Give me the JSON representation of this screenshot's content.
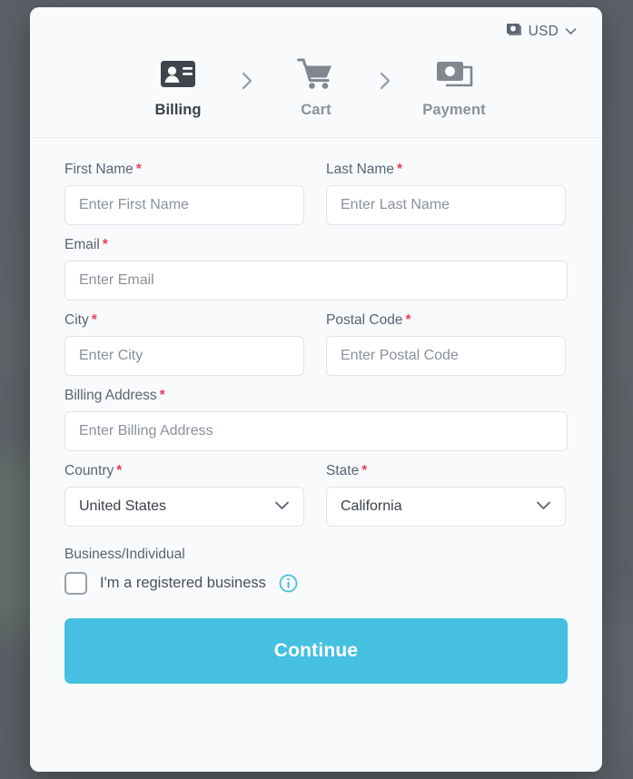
{
  "overlay": {
    "backdrop_color": "#5c6268"
  },
  "modal": {
    "background": "#f9fafc",
    "currency": {
      "icon": "banknotes-icon",
      "label": "USD",
      "chevron": "chevron-down-icon"
    },
    "steps": [
      {
        "id": "billing",
        "label": "Billing",
        "icon": "id-card-icon",
        "state": "active"
      },
      {
        "id": "cart",
        "label": "Cart",
        "icon": "shopping-cart-icon",
        "state": "inactive"
      },
      {
        "id": "payment",
        "label": "Payment",
        "icon": "banknotes-icon",
        "state": "inactive"
      }
    ],
    "step_separator_icon": "chevron-right-icon"
  },
  "form": {
    "first_name": {
      "label": "First Name",
      "required": "*",
      "placeholder": "Enter First Name",
      "value": ""
    },
    "last_name": {
      "label": "Last Name",
      "required": "*",
      "placeholder": "Enter Last Name",
      "value": ""
    },
    "email": {
      "label": "Email",
      "required": "*",
      "placeholder": "Enter Email",
      "value": ""
    },
    "city": {
      "label": "City",
      "required": "*",
      "placeholder": "Enter City",
      "value": ""
    },
    "postal_code": {
      "label": "Postal Code",
      "required": "*",
      "placeholder": "Enter Postal Code",
      "value": ""
    },
    "billing_address": {
      "label": "Billing Address",
      "required": "*",
      "placeholder": "Enter Billing Address",
      "value": ""
    },
    "country": {
      "label": "Country",
      "required": "*",
      "value": "United States",
      "chevron": "chevron-down-icon"
    },
    "state": {
      "label": "State",
      "required": "*",
      "value": "California",
      "chevron": "chevron-down-icon"
    },
    "business": {
      "section_label": "Business/Individual",
      "checkbox_label": "I'm a registered business",
      "checked": false,
      "info_icon": "info-circle-icon",
      "info_icon_color": "#45c0e0"
    }
  },
  "actions": {
    "continue_label": "Continue",
    "continue_color": "#45c0e0"
  }
}
